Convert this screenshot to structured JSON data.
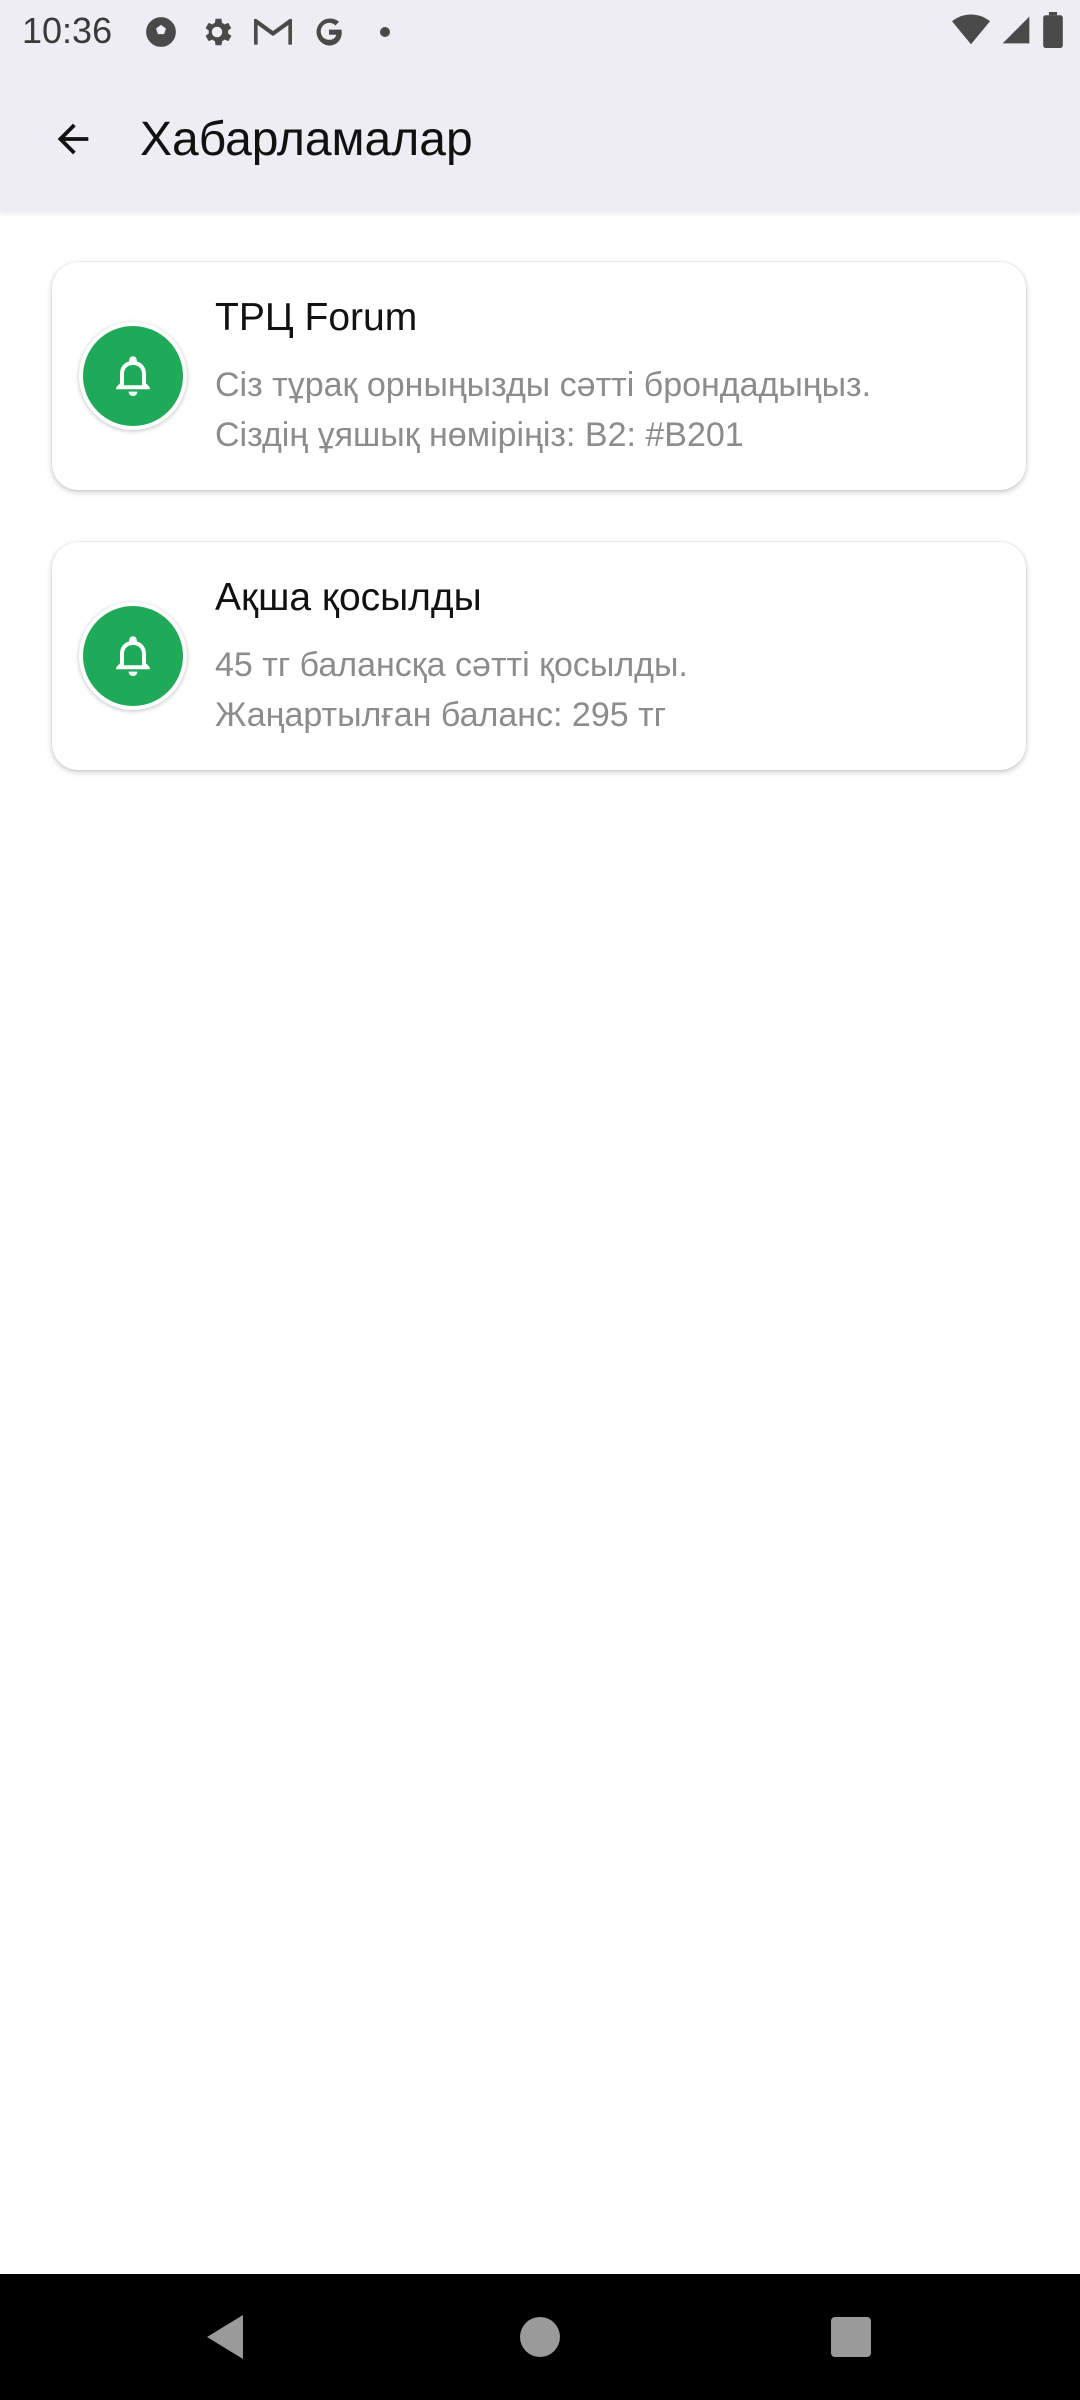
{
  "status_bar": {
    "time": "10:36",
    "icons": [
      "soccer-ball-icon",
      "settings-gear-icon",
      "gmail-icon",
      "google-icon",
      "dot-icon",
      "wifi-icon",
      "signal-icon",
      "battery-icon"
    ]
  },
  "app_bar": {
    "title": "Хабарламалар",
    "back_icon": "arrow-left-icon",
    "background": "#efedf4"
  },
  "notifications": [
    {
      "title": "ТРЦ Forum",
      "line1": "Сіз тұрақ орныңызды сәтті брондадыңыз.",
      "line2": "Сіздің ұяшық нөміріңіз: B2: #B201",
      "icon": "bell-icon"
    },
    {
      "title": "Ақша қосылды",
      "line1": "45 тг балансқа сәтті қосылды.",
      "line2": "Жаңартылған баланс: 295 тг",
      "icon": "bell-icon"
    }
  ],
  "colors": {
    "accent_green": "#1faa5a",
    "secondary_text": "#8c8c8c"
  },
  "nav_bar": {
    "buttons": [
      "back-triangle-icon",
      "home-circle-icon",
      "recents-square-icon"
    ]
  }
}
